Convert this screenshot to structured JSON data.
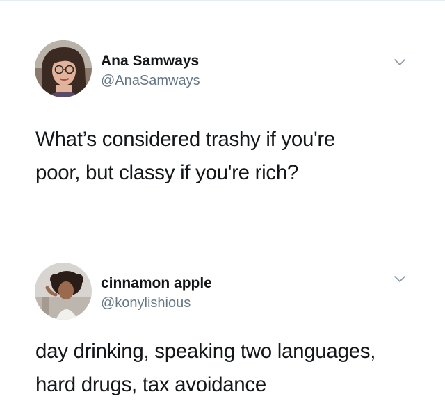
{
  "tweets": [
    {
      "display_name": "Ana Samways",
      "handle": "@AnaSamways",
      "text_lines": [
        "What’s considered trashy if you're",
        "poor, but classy if you're rich?"
      ],
      "menu_icon": "chevron-down-icon",
      "avatar": "avatar-photo"
    },
    {
      "display_name": "cinnamon apple",
      "handle": "@konylishious",
      "text_lines": [
        "day drinking, speaking two languages,",
        "hard drugs, tax avoidance"
      ],
      "menu_icon": "chevron-down-icon",
      "avatar": "avatar-photo"
    }
  ],
  "colors": {
    "text_primary": "#14171a",
    "text_secondary": "#657786",
    "chevron": "#8899a6",
    "divider": "#e6ecf0"
  }
}
